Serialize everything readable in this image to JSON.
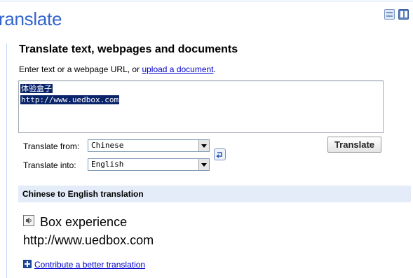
{
  "header": {
    "title": "ranslate",
    "layout_icons": [
      "single-panel-icon",
      "split-panel-icon"
    ]
  },
  "form": {
    "heading": "Translate text, webpages and documents",
    "instruction_prefix": "Enter text or a webpage URL, or ",
    "upload_link": "upload a document",
    "instruction_suffix": ".",
    "source_lines": [
      "体验盒子",
      "http://www.uedbox.com"
    ],
    "from_label": "Translate from:",
    "from_value": "Chinese",
    "into_label": "Translate into:",
    "into_value": "English",
    "translate_button": "Translate"
  },
  "result": {
    "header": "Chinese to English translation",
    "lines": [
      "Box experience",
      "http://www.uedbox.com"
    ],
    "contribute_link": "Contribute a better translation"
  },
  "colors": {
    "title_blue": "#3366cc",
    "link_blue": "#0000cc",
    "result_bar": "#e5ecf9",
    "selection": "#0a246a"
  }
}
